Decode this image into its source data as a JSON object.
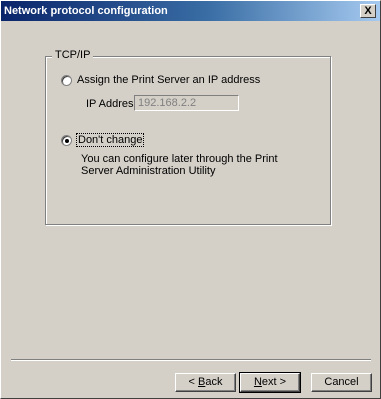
{
  "window": {
    "title": "Network protocol configuration",
    "close_glyph": "X"
  },
  "group": {
    "legend": "TCP/IP"
  },
  "options": {
    "assign_label": "Assign the Print Server an IP address",
    "assign_checked": false,
    "ip_label": "IP Address",
    "ip_value": "192.168.2.2",
    "dont_change_label": "Don't change",
    "dont_change_checked": true,
    "dont_change_desc": "You can configure later through the Print Server Administration Utility"
  },
  "buttons": {
    "back_prefix": "< ",
    "back_key": "B",
    "back_rest": "ack",
    "next_key": "N",
    "next_rest": "ext >",
    "cancel": "Cancel"
  }
}
